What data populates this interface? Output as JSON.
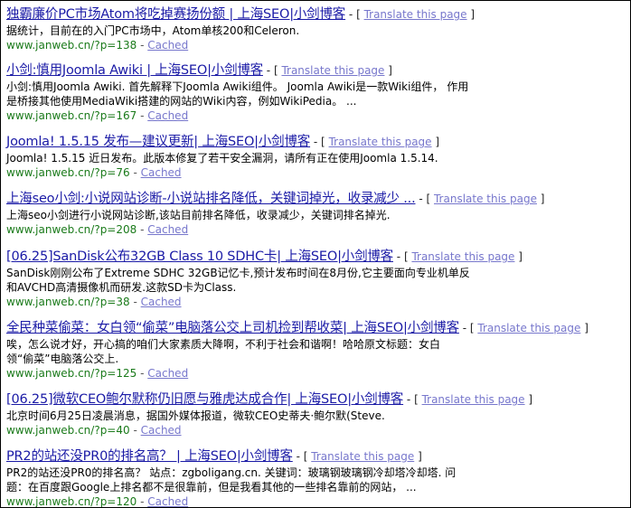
{
  "results": [
    {
      "title": "独霸廉价PC市场Atom将吃掉赛扬份额 | 上海SEO|小剑博客",
      "snippet": [
        "据统计，目前在的入门PC市场中，Atom单核200和Celeron."
      ],
      "url": "www.janweb.cn/?p=138"
    },
    {
      "title": "小剑:慎用Joomla Awiki | 上海SEO|小剑博客",
      "snippet": [
        "小剑:慎用Joomla Awiki. 首先解释下Joomla Awiki组件。 Joomla Awiki是一款Wiki组件， 作用",
        "是桥接其他使用MediaWiki搭建的网站的Wiki内容，例如WikiPedia。 ..."
      ],
      "url": "www.janweb.cn/?p=167"
    },
    {
      "title": "Joomla! 1.5.15 发布—建议更新| 上海SEO|小剑博客",
      "snippet": [
        "Joomla! 1.5.15 近日发布。此版本修复了若干安全漏洞，请所有正在使用Joomla 1.5.14."
      ],
      "url": "www.janweb.cn/?p=76"
    },
    {
      "title": "上海seo小剑:小说网站诊断-小说站排名降低，关键词掉光，收录减少 ...",
      "snippet": [
        "上海seo小剑进行小说网站诊断,该站目前排名降低，收录减少，关键词排名掉光."
      ],
      "url": "www.janweb.cn/?p=208"
    },
    {
      "title": "[06.25]SanDisk公布32GB Class 10 SDHC卡| 上海SEO|小剑博客",
      "snippet": [
        "SanDisk刚刚公布了Extreme SDHC 32GB记忆卡,预计发布时间在8月份,它主要面向专业机单反",
        "和AVCHD高清摄像机而研发.这款SD卡为Class."
      ],
      "url": "www.janweb.cn/?p=38"
    },
    {
      "title": "全民种菜偷菜：女白领“偷菜”电脑落公交上司机捡到帮收菜| 上海SEO|小剑博客",
      "snippet": [
        "唉，怎么说才好，开心搞的咱们大家素质大降啊，不利于社会和谐啊！哈哈原文标题：女白",
        "领“偷菜”电脑落公交上."
      ],
      "url": "www.janweb.cn/?p=125"
    },
    {
      "title": "[06.25]微软CEO鲍尔默称仍旧愿与雅虎达成合作| 上海SEO|小剑博客",
      "snippet": [
        "北京时间6月25日凌晨消息，据国外媒体报道，微软CEO史蒂夫·鲍尔默(Steve."
      ],
      "url": "www.janweb.cn/?p=40"
    },
    {
      "title": "PR2的站还没PR0的排名高？ | 上海SEO|小剑博客",
      "snippet": [
        "PR2的站还没PR0的排名高？ 站点：zgboligang.cn. 关键词：玻璃钢玻璃钢冷却塔冷却塔. 问",
        "题：在百度跟Google上排名都不是很靠前，但是我看其他的一些排名靠前的网站， ..."
      ],
      "url": "www.janweb.cn/?p=120"
    }
  ],
  "labels": {
    "translate": "Translate this page",
    "cached": "Cached",
    "sep_dash": " - ",
    "bracket_open": "[",
    "bracket_close": "]"
  },
  "colors": {
    "title_link": "#1a1aa6",
    "url_green": "#1a7a1a",
    "translate_link": "#7777cc"
  }
}
